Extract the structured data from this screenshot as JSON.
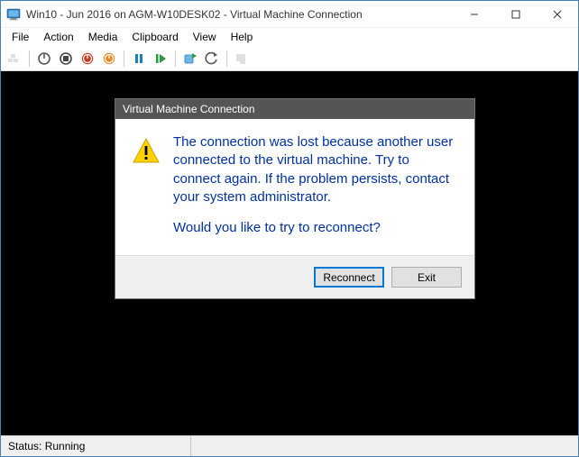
{
  "window": {
    "title": "Win10 - Jun 2016 on AGM-W10DESK02 - Virtual Machine Connection"
  },
  "menu": {
    "items": [
      "File",
      "Action",
      "Media",
      "Clipboard",
      "View",
      "Help"
    ]
  },
  "toolbar": {
    "buttons": [
      {
        "name": "ctrl-alt-del-icon",
        "enabled": false
      },
      {
        "name": "start-icon",
        "enabled": true
      },
      {
        "name": "turnoff-icon",
        "enabled": true
      },
      {
        "name": "shutdown-icon",
        "enabled": true
      },
      {
        "name": "save-icon",
        "enabled": true
      },
      {
        "name": "pause-icon",
        "enabled": true
      },
      {
        "name": "reset-icon",
        "enabled": true
      },
      {
        "name": "checkpoint-icon",
        "enabled": true
      },
      {
        "name": "revert-icon",
        "enabled": true
      },
      {
        "name": "enhanced-session-icon",
        "enabled": false
      }
    ]
  },
  "dialog": {
    "title": "Virtual Machine Connection",
    "message": "The connection was lost because another user connected to the virtual machine. Try to connect again. If the problem persists, contact your system administrator.",
    "question": "Would you like to try to reconnect?",
    "reconnect_label": "Reconnect",
    "exit_label": "Exit"
  },
  "status": {
    "label": "Status: Running"
  }
}
